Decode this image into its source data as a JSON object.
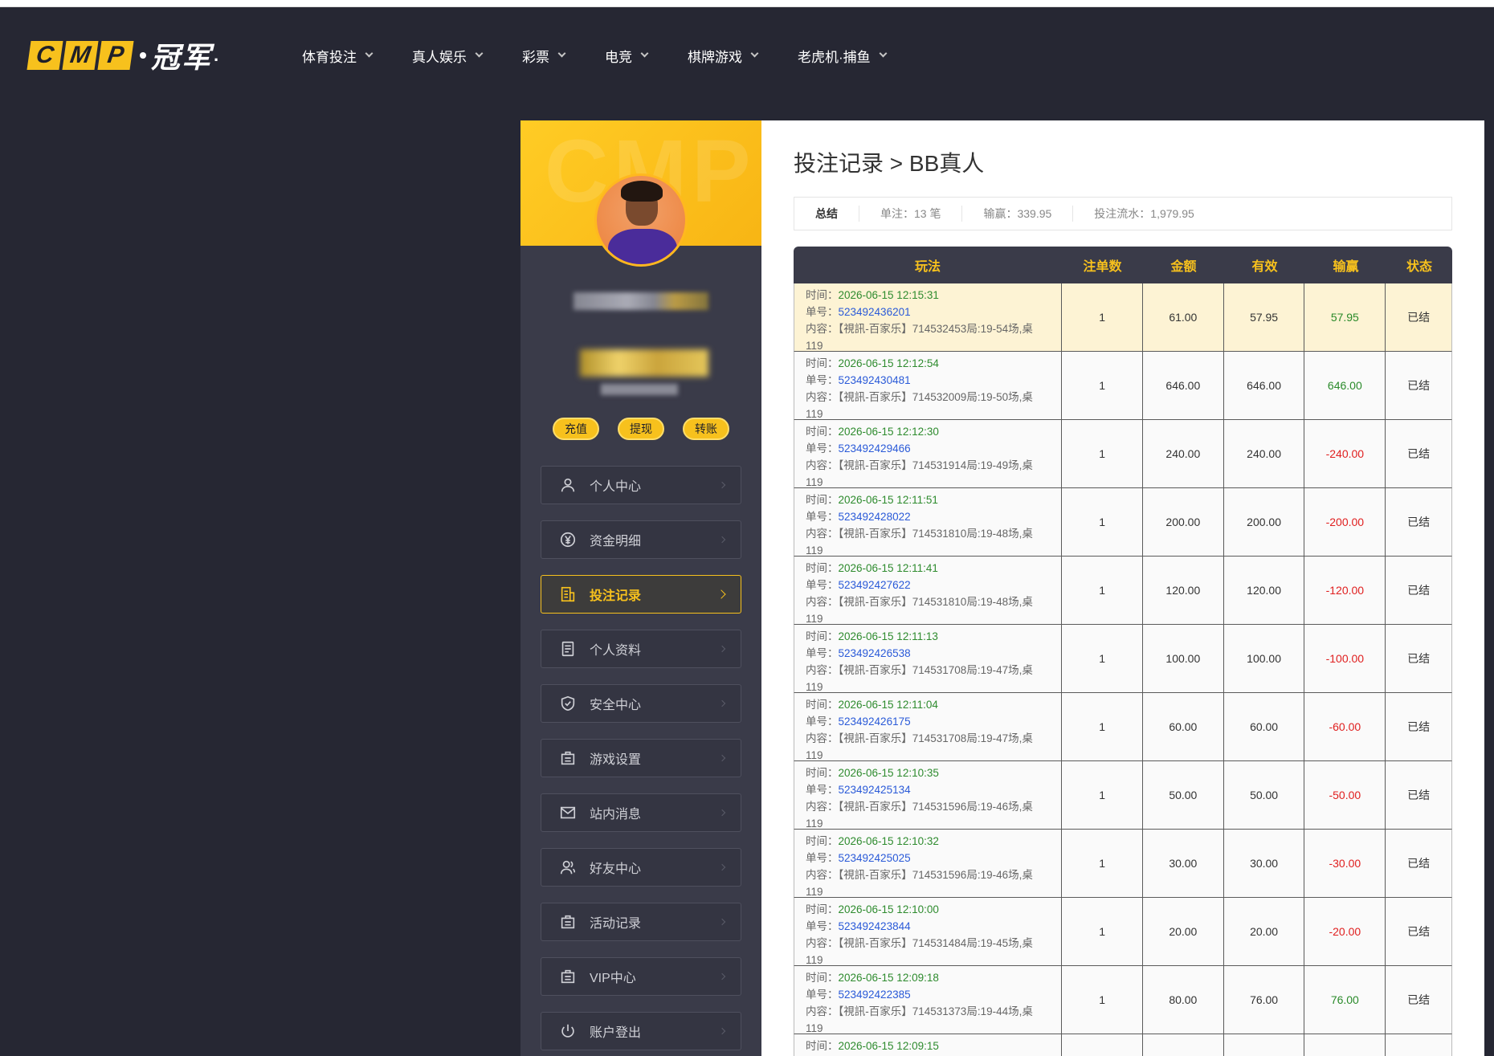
{
  "logo": {
    "letters": [
      "C",
      "M",
      "P"
    ],
    "cn": "冠军",
    "tail": "."
  },
  "nav": [
    {
      "label": "体育投注"
    },
    {
      "label": "真人娱乐"
    },
    {
      "label": "彩票"
    },
    {
      "label": "电竞"
    },
    {
      "label": "棋牌游戏"
    },
    {
      "label": "老虎机·捕鱼"
    }
  ],
  "sidebar": {
    "banner_watermark": "CMP",
    "quick_actions": [
      "充值",
      "提现",
      "转账"
    ],
    "menu": [
      {
        "label": "个人中心",
        "icon": "user-icon"
      },
      {
        "label": "资金明细",
        "icon": "yen-circle-icon"
      },
      {
        "label": "投注记录",
        "icon": "bet-record-icon",
        "active": true
      },
      {
        "label": "个人资料",
        "icon": "profile-doc-icon"
      },
      {
        "label": "安全中心",
        "icon": "shield-check-icon"
      },
      {
        "label": "游戏设置",
        "icon": "game-settings-icon"
      },
      {
        "label": "站内消息",
        "icon": "mail-icon"
      },
      {
        "label": "好友中心",
        "icon": "friends-icon"
      },
      {
        "label": "活动记录",
        "icon": "activity-record-icon"
      },
      {
        "label": "VIP中心",
        "icon": "vip-icon"
      },
      {
        "label": "账户登出",
        "icon": "power-icon"
      }
    ]
  },
  "main": {
    "title": "投注记录 > BB真人",
    "summary": {
      "label": "总结",
      "count": "单注：13 笔",
      "winloss": "输赢：339.95",
      "turnover": "投注流水：1,979.95"
    },
    "columns": [
      "玩法",
      "注单数",
      "金额",
      "有效",
      "输赢",
      "状态"
    ],
    "row_labels": {
      "time": "时间：",
      "order": "单号：",
      "content": "内容："
    },
    "rows": [
      {
        "time": "2026-06-15 12:15:31",
        "order": "523492436201",
        "content": "【視訊-百家乐】714532453局:19-54场,桌",
        "content2": "119",
        "count": "1",
        "amount": "61.00",
        "valid": "57.95",
        "winloss": "57.95",
        "status": "已结",
        "result": "win"
      },
      {
        "time": "2026-06-15 12:12:54",
        "order": "523492430481",
        "content": "【視訊-百家乐】714532009局:19-50场,桌",
        "content2": "119",
        "count": "1",
        "amount": "646.00",
        "valid": "646.00",
        "winloss": "646.00",
        "status": "已结",
        "result": "win"
      },
      {
        "time": "2026-06-15 12:12:30",
        "order": "523492429466",
        "content": "【視訊-百家乐】714531914局:19-49场,桌",
        "content2": "119",
        "count": "1",
        "amount": "240.00",
        "valid": "240.00",
        "winloss": "-240.00",
        "status": "已结",
        "result": "lose"
      },
      {
        "time": "2026-06-15 12:11:51",
        "order": "523492428022",
        "content": "【視訊-百家乐】714531810局:19-48场,桌",
        "content2": "119",
        "count": "1",
        "amount": "200.00",
        "valid": "200.00",
        "winloss": "-200.00",
        "status": "已结",
        "result": "lose"
      },
      {
        "time": "2026-06-15 12:11:41",
        "order": "523492427622",
        "content": "【視訊-百家乐】714531810局:19-48场,桌",
        "content2": "119",
        "count": "1",
        "amount": "120.00",
        "valid": "120.00",
        "winloss": "-120.00",
        "status": "已结",
        "result": "lose"
      },
      {
        "time": "2026-06-15 12:11:13",
        "order": "523492426538",
        "content": "【視訊-百家乐】714531708局:19-47场,桌",
        "content2": "119",
        "count": "1",
        "amount": "100.00",
        "valid": "100.00",
        "winloss": "-100.00",
        "status": "已结",
        "result": "lose"
      },
      {
        "time": "2026-06-15 12:11:04",
        "order": "523492426175",
        "content": "【視訊-百家乐】714531708局:19-47场,桌",
        "content2": "119",
        "count": "1",
        "amount": "60.00",
        "valid": "60.00",
        "winloss": "-60.00",
        "status": "已结",
        "result": "lose"
      },
      {
        "time": "2026-06-15 12:10:35",
        "order": "523492425134",
        "content": "【視訊-百家乐】714531596局:19-46场,桌",
        "content2": "119",
        "count": "1",
        "amount": "50.00",
        "valid": "50.00",
        "winloss": "-50.00",
        "status": "已结",
        "result": "lose"
      },
      {
        "time": "2026-06-15 12:10:32",
        "order": "523492425025",
        "content": "【視訊-百家乐】714531596局:19-46场,桌",
        "content2": "119",
        "count": "1",
        "amount": "30.00",
        "valid": "30.00",
        "winloss": "-30.00",
        "status": "已结",
        "result": "lose"
      },
      {
        "time": "2026-06-15 12:10:00",
        "order": "523492423844",
        "content": "【視訊-百家乐】714531484局:19-45场,桌",
        "content2": "119",
        "count": "1",
        "amount": "20.00",
        "valid": "20.00",
        "winloss": "-20.00",
        "status": "已结",
        "result": "lose"
      },
      {
        "time": "2026-06-15 12:09:18",
        "order": "523492422385",
        "content": "【視訊-百家乐】714531373局:19-44场,桌",
        "content2": "119",
        "count": "1",
        "amount": "80.00",
        "valid": "76.00",
        "winloss": "76.00",
        "status": "已结",
        "result": "win"
      },
      {
        "time": "2026-06-15 12:09:15",
        "order": "",
        "content": "",
        "content2": "",
        "count": "",
        "amount": "",
        "valid": "",
        "winloss": "",
        "status": "",
        "result": ""
      }
    ]
  },
  "colors": {
    "accent": "#f7c11d",
    "bg": "#262733",
    "win": "#2a8a2a",
    "lose": "#e02020",
    "highlight_row": "#fdf3d4"
  }
}
